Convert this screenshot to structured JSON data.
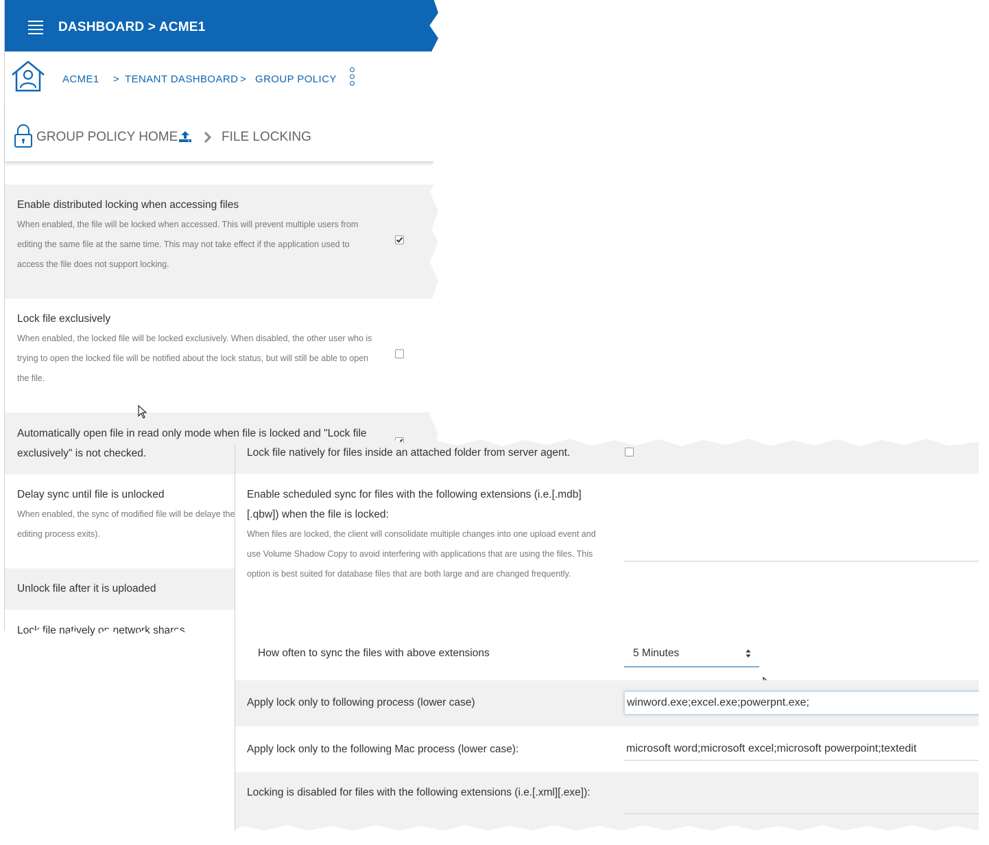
{
  "header": {
    "title": "DASHBOARD > ACME1"
  },
  "breadcrumb": {
    "items": [
      "ACME1",
      "TENANT DASHBOARD",
      "GROUP POLICY"
    ],
    "separator": ">"
  },
  "section": {
    "home_label": "GROUP POLICY HOME",
    "current": "FILE LOCKING"
  },
  "settings_left": [
    {
      "title": "Enable distributed locking when accessing files",
      "desc": "When enabled, the file will be locked when accessed. This will prevent multiple users from editing the same file at the same time. This may not take effect if the application used to access the file does not support locking.",
      "checked": true
    },
    {
      "title": "Lock file exclusively",
      "desc": "When enabled, the locked file will be locked exclusively. When disabled, the other user who is trying to open the locked file will be notified about the lock status, but will still be able to open the file.",
      "checked": false
    },
    {
      "title": "Automatically open file in read only mode when file is locked and \"Lock file exclusively\" is not checked.",
      "checked": true
    },
    {
      "title": "Delay sync until file is unlocked",
      "desc": "When enabled, the sync of modified file will be delaye the editing process exits)."
    },
    {
      "title": "Unlock file after it is uploaded"
    },
    {
      "title": "Lock file natively on network shares"
    }
  ],
  "settings_right": {
    "agent_lock": {
      "title": "Lock file natively for files inside an attached folder from server agent.",
      "checked": false
    },
    "scheduled_sync": {
      "title": "Enable scheduled sync for files with the following extensions (i.e.[.mdb][.qbw]) when the file is locked:",
      "desc": "When files are locked, the client will consolidate multiple changes into one upload event and use Volume Shadow Copy to avoid interfering with applications that are using the files. This option is best suited for database files that are both large and are changed frequently.",
      "value": ""
    },
    "sync_interval": {
      "title": "How often to sync the files with above extensions",
      "value": "5 Minutes"
    },
    "process_list": {
      "title": "Apply lock only to following process (lower case)",
      "value": "winword.exe;excel.exe;powerpnt.exe;"
    },
    "mac_process_list": {
      "title": "Apply lock only to the following Mac process (lower case):",
      "value": "microsoft word;microsoft excel;microsoft powerpoint;textedit"
    },
    "disabled_extensions": {
      "title": "Locking is disabled for files with the following extensions (i.e.[.xml][.exe]):",
      "value": ""
    }
  },
  "icons": {
    "menu": "hamburger-icon",
    "home": "home-user-icon",
    "more": "kebab-vertical-icon",
    "lock": "padlock-icon",
    "upload": "upload-icon",
    "chevron": "chevron-right-icon"
  },
  "colors": {
    "brand": "#0e66b4",
    "row_alt": "#f1f1f1"
  }
}
